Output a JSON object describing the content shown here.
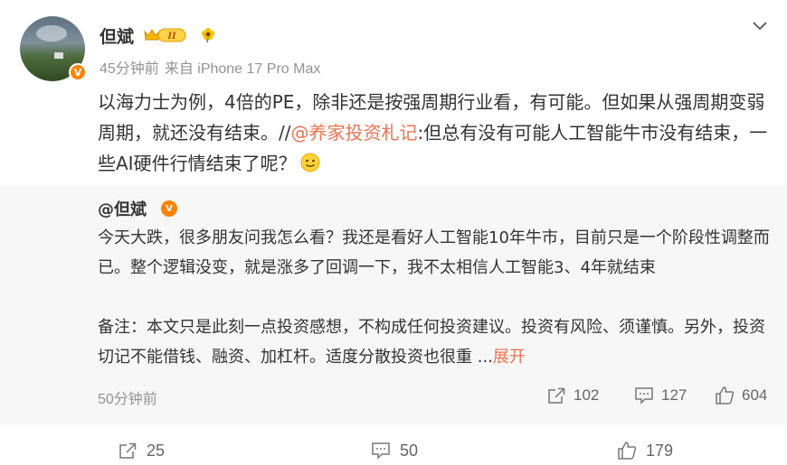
{
  "author": {
    "name": "但斌",
    "level_badge": "II",
    "time": "45分钟前",
    "source": "来自 iPhone 17 Pro Max"
  },
  "post": {
    "text_before": "以海力士为例，4倍的PE，除非还是按强周期行业看，有可能。但如果从强周期变弱周期，就还没有结束。//",
    "mention": "@养家投资札记",
    "text_after": ":但总有没有可能人工智能牛市没有结束，一些AI硬件行情结束了呢？"
  },
  "repost": {
    "author": "@但斌",
    "paragraph1": "今天大跌，很多朋友问我怎么看？我还是看好人工智能10年牛市，目前只是一个阶段性调整而已。整个逻辑没变，就是涨多了回调一下，我不太相信人工智能3、4年就结束",
    "paragraph2": "备注：本文只是此刻一点投资感想，不构成任何投资建议。投资有风险、须谨慎。另外，投资切记不能借钱、融资、加杠杆。适度分散投资也很重 ...",
    "expand": "展开",
    "time": "50分钟前",
    "reposts": "102",
    "comments": "127",
    "likes": "604"
  },
  "toolbar": {
    "reposts": "25",
    "comments": "50",
    "likes": "179"
  },
  "colors": {
    "accent": "#eb7350",
    "badge_orange": "#ff8200",
    "muted": "#939393",
    "repost_bg": "#f7f7f7"
  }
}
